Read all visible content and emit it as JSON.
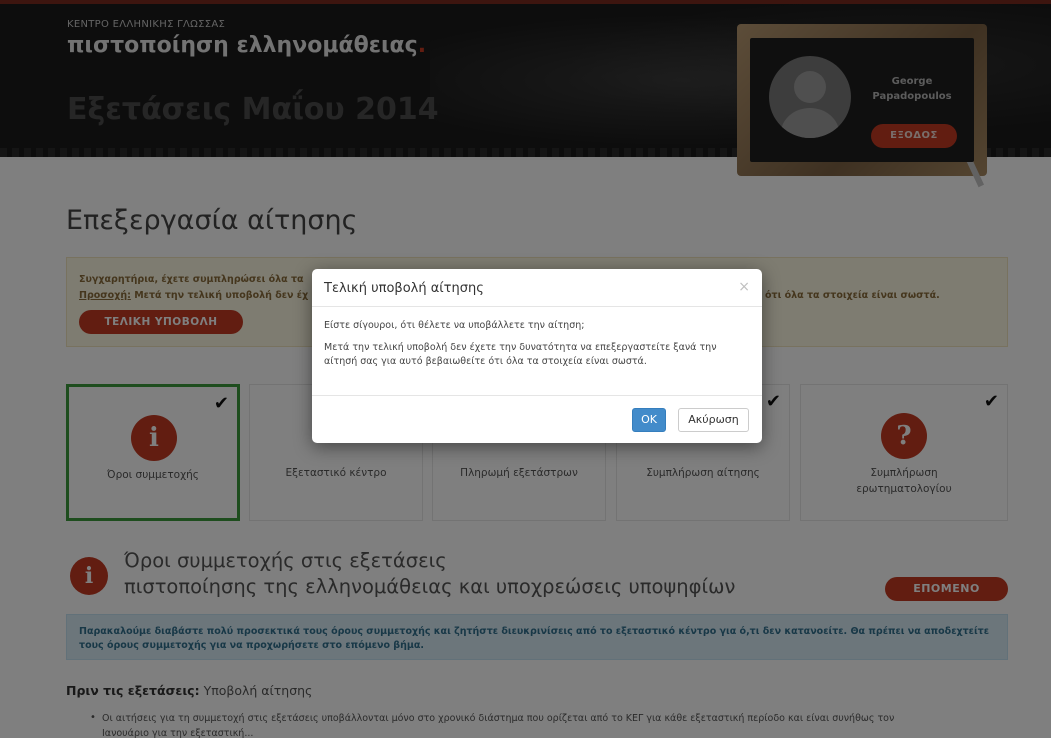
{
  "header": {
    "org_name": "ΚΕΝΤΡΟ ΕΛΛΗΝΙΚΗΣ ΓΛΩΣΣΑΣ",
    "program_name": "πιστοποίηση ελληνομάθειας",
    "program_dot": ".",
    "exam_title": "Εξετάσεις Μαΐου 2014",
    "user": {
      "name_first": "George",
      "name_last": "Papadopoulos",
      "logout_label": "ΕΞΟΔΟΣ"
    }
  },
  "page": {
    "title": "Επεξεργασία αίτησης",
    "notice": {
      "line1": "Συγχαρητήρια, έχετε συμπληρώσει όλα τα",
      "warning_label": "Προσοχή:",
      "line2": " Μετά την τελική υποβολή δεν έχ",
      "line2_tail": "ότι όλα τα στοιχεία είναι σωστά.",
      "final_submit_label": "ΤΕΛΙΚΗ ΥΠΟΒΟΛΗ"
    },
    "steps": [
      {
        "label": "Όροι συμμετοχής",
        "icon": "info-icon",
        "glyph": "i",
        "done": true,
        "active": true
      },
      {
        "label": "Εξεταστικό κέντρο",
        "done": false,
        "active": false
      },
      {
        "label": "Πληρωμή εξετάστρων",
        "done": false,
        "active": false
      },
      {
        "label": "Συμπλήρωση αίτησης",
        "done": true,
        "active": false
      },
      {
        "label": "Συμπλήρωση ερωτηματολογίου",
        "icon": "question-icon",
        "glyph": "?",
        "done": true,
        "active": false
      }
    ],
    "check_glyph": "✔",
    "section": {
      "glyph": "i",
      "title_line1": "Όροι συμμετοχής στις εξετάσεις",
      "title_line2": "πιστοποίησης της ελληνομάθειας και υποχρεώσεις υποψηφίων",
      "next_label": "ΕΠΟΜΕΝΟ"
    },
    "info_text": "Παρακαλούμε διαβάστε πολύ προσεκτικά τους όρους συμμετοχής και ζητήστε διευκρινίσεις από το εξεταστικό κέντρο για ό,τι δεν κατανοείτε. Θα πρέπει να αποδεχτείτε τους όρους συμμετοχής για να προχωρήσετε στο επόμενο βήμα.",
    "before_exams": {
      "label": "Πριν τις εξετάσεις:",
      "rest": " Υποβολή αίτησης"
    },
    "bullet_dot": "•",
    "bullet1": "Οι αιτήσεις για τη συμμετοχή στις εξετάσεις υποβάλλονται μόνο στο χρονικό διάστημα που ορίζεται από το ΚΕΓ για κάθε εξεταστική περίοδο και είναι συνήθως τον",
    "bullet1_cont": "Ιανουάριο για την εξεταστική..."
  },
  "modal": {
    "title": "Τελική υποβολή αίτησης",
    "close_glyph": "×",
    "question": "Είστε σίγουροι, ότι θέλετε να υποβάλλετε την αίτηση;",
    "warning": "Μετά την τελική υποβολή δεν έχετε την δυνατότητα να επεξεργαστείτε ξανά την αίτησή σας για αυτό βεβαιωθείτε ότι όλα τα στοιχεία είναι σωστά.",
    "ok_label": "OK",
    "cancel_label": "Ακύρωση"
  },
  "colors": {
    "accent": "#c43a22",
    "success": "#3c9b3c",
    "primary": "#428bca"
  }
}
